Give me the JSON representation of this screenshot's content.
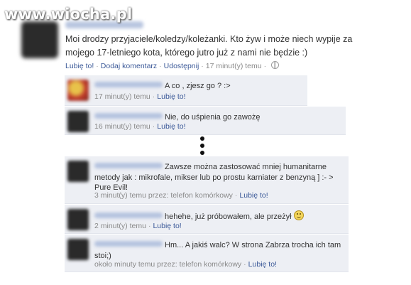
{
  "watermark": "www.wiocha.pl",
  "post": {
    "text": "Moi drodzy przyjaciele/koledzy/koleżanki. Kto żyw i może niech wypije za mojego 17-letniego kota, którego jutro już z nami nie będzie :)",
    "like": "Lubię to!",
    "comment": "Dodaj komentarz",
    "share": "Udostępnij",
    "time": "17 minut(y) temu",
    "privacy_icon": "globe-icon"
  },
  "comments": [
    {
      "text": "A co , zjesz go ? :>",
      "time": "17 minut(y) temu",
      "like": "Lubię to!",
      "via": ""
    },
    {
      "text": "Nie, do uśpienia go zawożę",
      "time": "16 minut(y) temu",
      "like": "Lubię to!",
      "via": ""
    },
    {
      "text": "Zawsze można zastosować mniej humanitarne metody jak : mikrofale, mikser lub po prostu karniater z benzyną ] :- > Pure Evil!",
      "time": "3 minut(y) temu przez: telefon komórkowy",
      "like": "Lubię to!"
    },
    {
      "text": "hehehe, już próbowałem, ale przeżył",
      "time": "2 minut(y) temu",
      "like": "Lubię to!",
      "emoji": "smiley-icon"
    },
    {
      "text": "Hm... A jakiś walc? W strona Zabrza trocha ich tam stoi;)",
      "time": "około minuty temu przez: telefon komórkowy",
      "like": "Lubię to!"
    }
  ],
  "separator_icon": "vertical-ellipsis-icon",
  "colors": {
    "link": "#3b5998",
    "comment_bg": "#edeff4"
  }
}
